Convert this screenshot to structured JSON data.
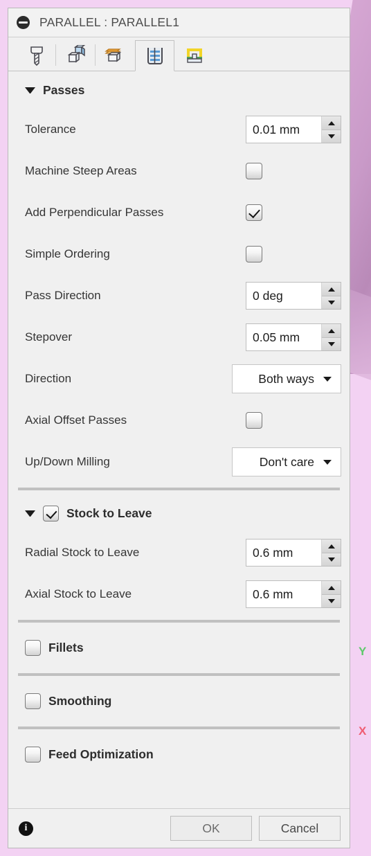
{
  "window": {
    "title": "PARALLEL : PARALLEL1",
    "title_icon": "minus-circle-icon"
  },
  "tabs": [
    {
      "name": "tool",
      "icon": "tool-bit-icon",
      "selected": false
    },
    {
      "name": "geometry",
      "icon": "geometry-cube-icon",
      "selected": false
    },
    {
      "name": "heights",
      "icon": "heights-cube-icon",
      "selected": false
    },
    {
      "name": "passes",
      "icon": "passes-icon",
      "selected": true
    },
    {
      "name": "linking",
      "icon": "linking-icon",
      "selected": false
    }
  ],
  "sections": {
    "passes": {
      "title": "Passes",
      "expanded": true,
      "rows": [
        {
          "label": "Tolerance",
          "type": "spin",
          "value": "0.01 mm"
        },
        {
          "label": "Machine Steep Areas",
          "type": "checkbox",
          "checked": false
        },
        {
          "label": "Add Perpendicular Passes",
          "type": "checkbox",
          "checked": true
        },
        {
          "label": "Simple Ordering",
          "type": "checkbox",
          "checked": false
        },
        {
          "label": "Pass Direction",
          "type": "spin",
          "value": "0 deg"
        },
        {
          "label": "Stepover",
          "type": "spin",
          "value": "0.05 mm"
        },
        {
          "label": "Direction",
          "type": "combo",
          "value": "Both ways"
        },
        {
          "label": "Axial Offset Passes",
          "type": "checkbox",
          "checked": false
        },
        {
          "label": "Up/Down Milling",
          "type": "combo",
          "value": "Don't care"
        }
      ]
    },
    "stock_to_leave": {
      "title": "Stock to Leave",
      "expanded": true,
      "checked": true,
      "rows": [
        {
          "label": "Radial Stock to Leave",
          "type": "spin",
          "value": "0.6 mm"
        },
        {
          "label": "Axial Stock to Leave",
          "type": "spin",
          "value": "0.6 mm"
        }
      ]
    },
    "fillets": {
      "title": "Fillets",
      "expanded": false,
      "checked": false
    },
    "smoothing": {
      "title": "Smoothing",
      "expanded": false,
      "checked": false
    },
    "feed_optimization": {
      "title": "Feed Optimization",
      "expanded": false,
      "checked": false
    }
  },
  "footer": {
    "info_icon": "info-icon",
    "ok_label": "OK",
    "cancel_label": "Cancel"
  },
  "viewport": {
    "axis_y_label": "Y",
    "axis_x_label": "X",
    "background_color": "#f3d2f3",
    "axis_y_color": "#5ec96b",
    "axis_x_color": "#ef5d72"
  }
}
